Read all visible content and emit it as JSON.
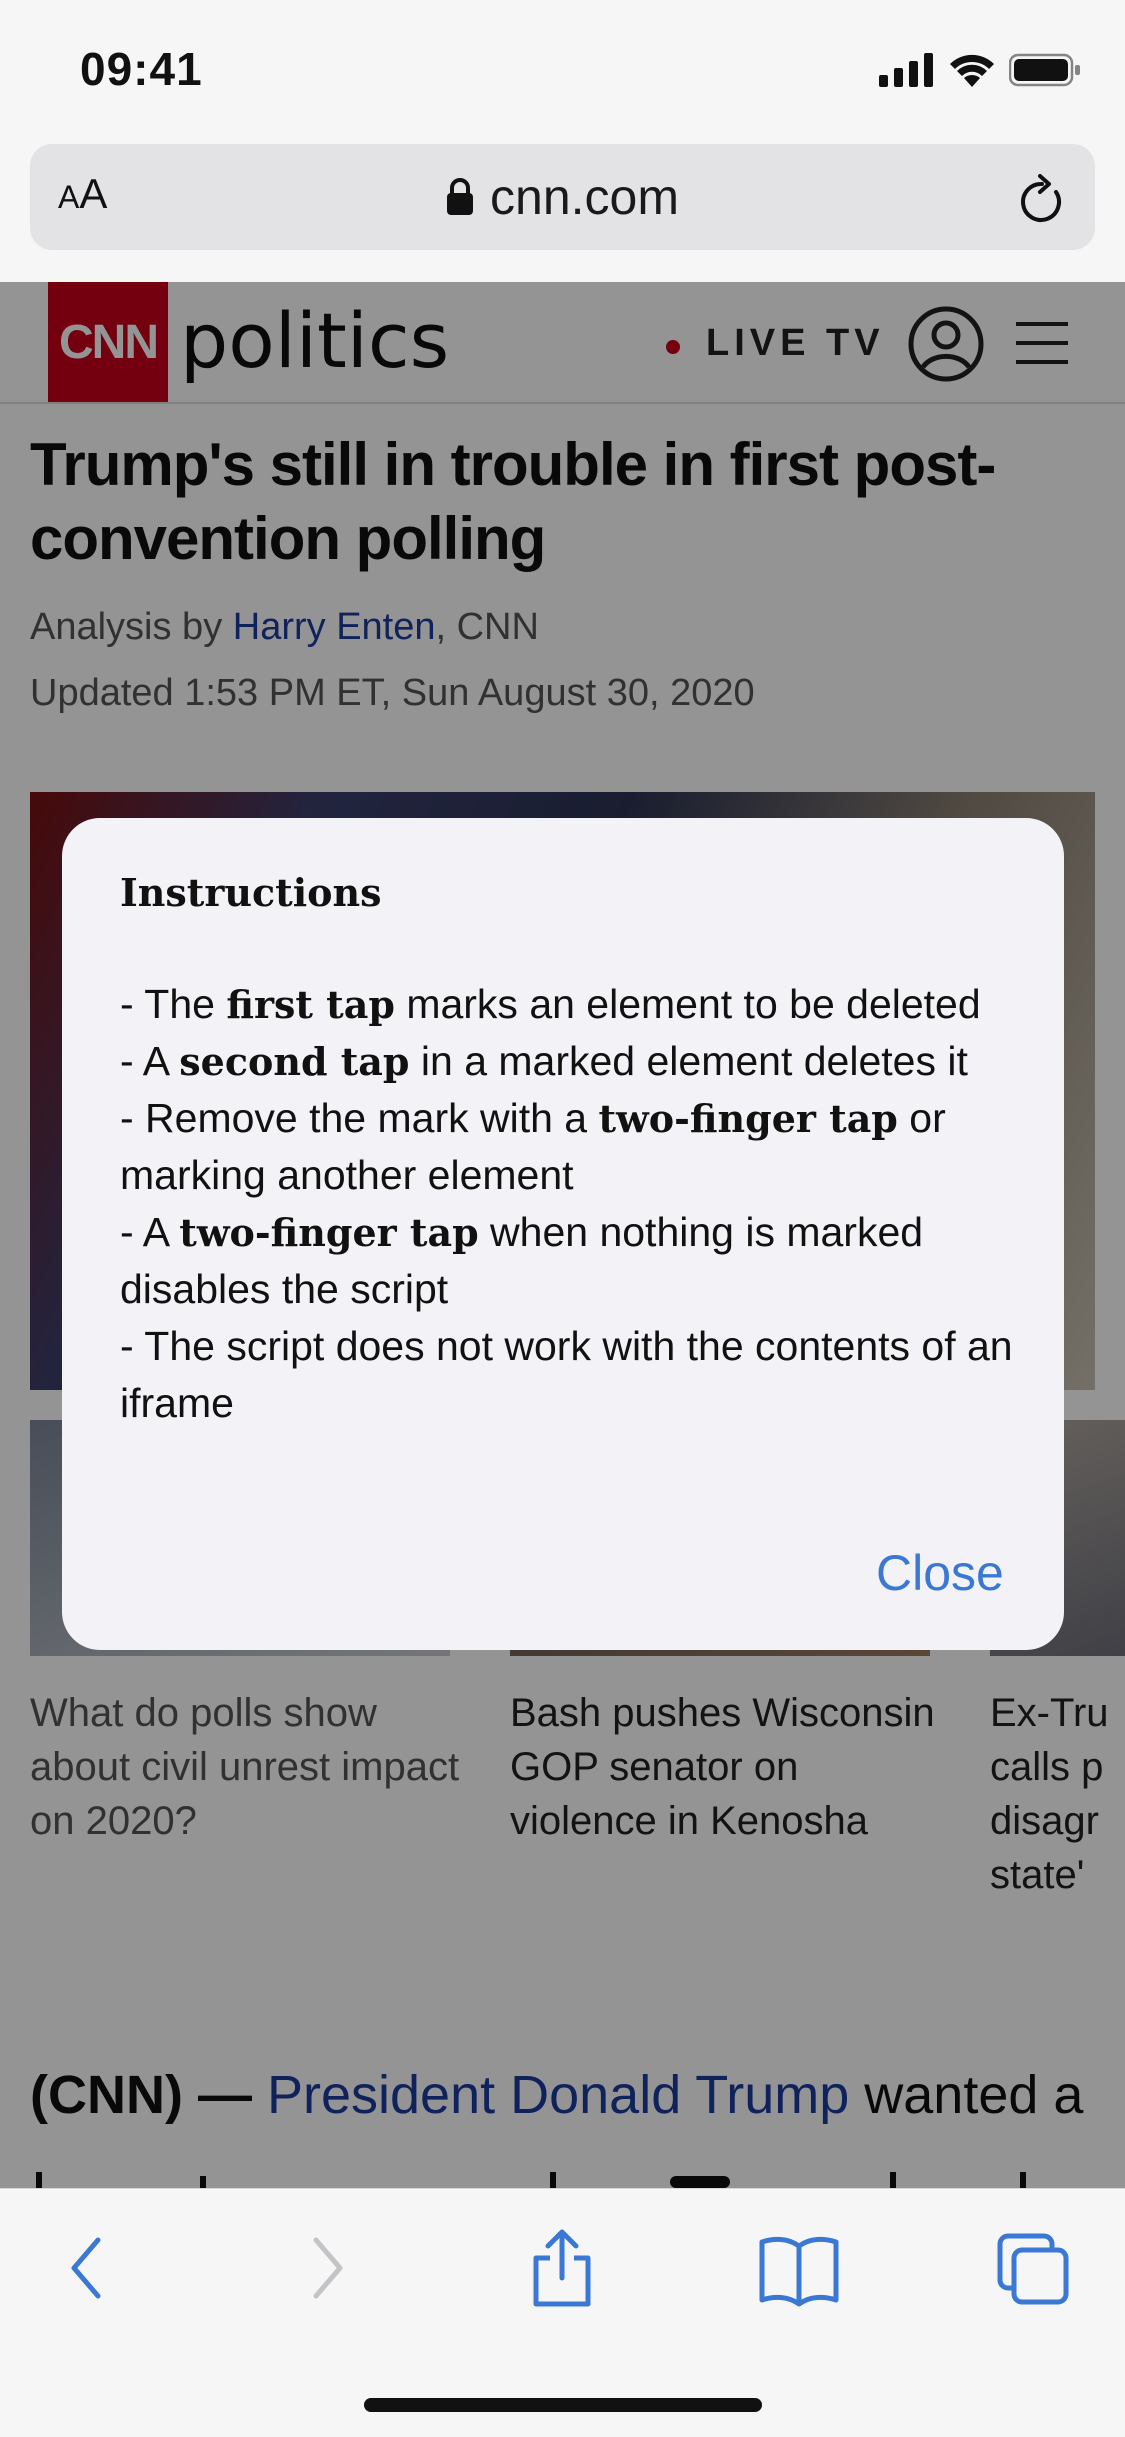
{
  "status_bar": {
    "time": "09:41"
  },
  "browser": {
    "text_size_small": "A",
    "text_size_large": "A",
    "url": "cnn.com"
  },
  "site": {
    "logo": "CNN",
    "section": "politics",
    "live_tv": "LIVE TV"
  },
  "article": {
    "headline": "Trump's still in trouble in first post-convention polling",
    "byline_prefix": "Analysis by ",
    "author": "Harry Enten",
    "byline_suffix": ", CNN",
    "updated": "Updated 1:53 PM ET, Sun August 30, 2020",
    "related": [
      {
        "title": "What do polls show about civil unrest impact on 2020?"
      },
      {
        "title": "Bash pushes Wisconsin GOP senator on violence in Kenosha"
      },
      {
        "title": "Ex-Tru calls p disagr state'"
      }
    ],
    "body_lead": "(CNN) — ",
    "body_link": "President Donald Trump",
    "body_rest": " wanted a"
  },
  "modal": {
    "title": "Instructions",
    "lines": [
      {
        "pre": " - The ",
        "bold": "first tap",
        "post": " marks an element to be deleted"
      },
      {
        "pre": " - A ",
        "bold": "second tap",
        "post": " in a marked element deletes it"
      },
      {
        "pre": " - Remove the mark with a ",
        "bold": "two-finger tap",
        "post": " or marking another element"
      },
      {
        "pre": " - A ",
        "bold": "two-finger tap",
        "post": " when nothing is marked disables the script"
      },
      {
        "pre": " - The script does not work with the contents of an iframe",
        "bold": "",
        "post": ""
      }
    ],
    "close_label": "Close"
  },
  "toolbar": {
    "icons": [
      "back-icon",
      "forward-icon",
      "share-icon",
      "bookmarks-icon",
      "tabs-icon"
    ]
  },
  "colors": {
    "cnn_red": "#c8001a",
    "link_blue": "#1d3c9e",
    "ios_blue": "#3a78d4"
  }
}
